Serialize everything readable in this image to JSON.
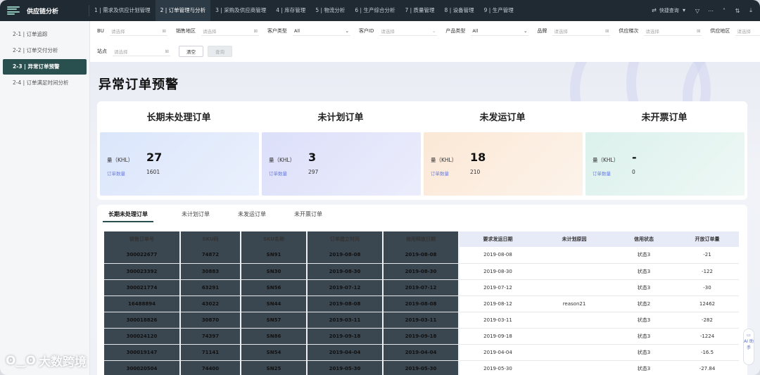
{
  "app": {
    "title": "供应链分析"
  },
  "nav": {
    "items": [
      {
        "label": "1 | 需求及供应计划管理",
        "active": false
      },
      {
        "label": "2 | 订单管理与分析",
        "active": true
      },
      {
        "label": "3 | 采购及供应商管理",
        "active": false
      },
      {
        "label": "4 | 库存管理",
        "active": false
      },
      {
        "label": "5 | 物流分析",
        "active": false
      },
      {
        "label": "6 | 生产综合分析",
        "active": false
      },
      {
        "label": "7 | 质量管理",
        "active": false
      },
      {
        "label": "8 | 设备管理",
        "active": false
      },
      {
        "label": "9 | 生产管理",
        "active": false
      }
    ],
    "quick_query": "快捷查询"
  },
  "sidebar": {
    "items": [
      {
        "label": "2-1 | 订单追踪",
        "active": false
      },
      {
        "label": "2-2 | 订单交付分析",
        "active": false
      },
      {
        "label": "2-3 | 异常订单预警",
        "active": true
      },
      {
        "label": "2-4 | 订单满足时间分析",
        "active": false
      }
    ]
  },
  "filters": {
    "row1": [
      {
        "label": "BU",
        "value": "请选择",
        "kind": "clear"
      },
      {
        "label": "销售地区",
        "value": "请选择",
        "kind": "clear"
      },
      {
        "label": "客户类型",
        "value": "All",
        "kind": "dropdown"
      },
      {
        "label": "客户ID",
        "value": "请选择",
        "kind": "dropdown"
      },
      {
        "label": "产品类型",
        "value": "All",
        "kind": "dropdown"
      },
      {
        "label": "品牌",
        "value": "请选择",
        "kind": "clear"
      },
      {
        "label": "供应梯次",
        "value": "请选择",
        "kind": "clear"
      },
      {
        "label": "供应地区",
        "value": "请选择",
        "kind": "clear"
      }
    ],
    "row2": [
      {
        "label": "站点",
        "value": "请选择",
        "kind": "clear"
      }
    ],
    "clear_label": "清空",
    "query_label": "查询"
  },
  "page_title": "异常订单预警",
  "kpis": [
    {
      "title": "长期未处理订单",
      "l1": "量（KHL）",
      "v1": "27",
      "l2": "订单数量",
      "v2": "1601"
    },
    {
      "title": "未计划订单",
      "l1": "量（KHL）",
      "v1": "3",
      "l2": "订单数量",
      "v2": "297"
    },
    {
      "title": "未发运订单",
      "l1": "量（KHL）",
      "v1": "18",
      "l2": "订单数量",
      "v2": "210"
    },
    {
      "title": "未开票订单",
      "l1": "量（KHL）",
      "v1": "-",
      "l2": "订单数量",
      "v2": "0"
    }
  ],
  "tabs": [
    "长期未处理订单",
    "未计划订单",
    "未发运订单",
    "未开票订单"
  ],
  "table": {
    "headers": [
      "销售订单号",
      "SKU码",
      "SKU名称",
      "订单建立时间",
      "信用释放日期",
      "要求发运日期",
      "未计划原因",
      "信用状态",
      "开放订单量"
    ],
    "rows": [
      [
        "300022677",
        "74872",
        "SN91",
        "2019-08-08",
        "2019-08-08",
        "2019-08-08",
        "",
        "状态3",
        "-21"
      ],
      [
        "300023392",
        "30883",
        "SN30",
        "2019-08-30",
        "2019-08-30",
        "2019-08-30",
        "",
        "状态3",
        "-122"
      ],
      [
        "300021774",
        "63291",
        "SN56",
        "2019-07-12",
        "2019-07-12",
        "2019-07-12",
        "",
        "状态3",
        "-30"
      ],
      [
        "16488894",
        "43022",
        "SN44",
        "2019-08-08",
        "2019-08-08",
        "2019-08-12",
        "reason21",
        "状态2",
        "12462"
      ],
      [
        "300018826",
        "30870",
        "SN57",
        "2019-03-11",
        "2019-03-11",
        "2019-03-11",
        "",
        "状态3",
        "-282"
      ],
      [
        "300024120",
        "74397",
        "SN86",
        "2019-09-18",
        "2019-09-18",
        "2019-09-18",
        "",
        "状态3",
        "-1224"
      ],
      [
        "300019147",
        "71141",
        "SN54",
        "2019-04-04",
        "2019-04-04",
        "2019-04-04",
        "",
        "状态3",
        "-16.5"
      ],
      [
        "300020504",
        "74400",
        "SN25",
        "2019-05-30",
        "2019-05-30",
        "2019-05-30",
        "",
        "状态3",
        "-27.84"
      ]
    ]
  },
  "watermark": "大数跨境",
  "ai_assistant": "AI 助手",
  "icons": {
    "logo": "menu-lines-icon",
    "quick_query": "swap-icon",
    "filter": "filter-icon",
    "download": "download-icon",
    "refresh": "refresh-icon"
  },
  "colors": {
    "topbar": "#1f2a33",
    "sidebar_active": "#2a4f4f",
    "card1": "#dbe6fb",
    "card2": "#dcdff9",
    "card3": "#fbe8d6",
    "card4": "#dcf1ec"
  }
}
